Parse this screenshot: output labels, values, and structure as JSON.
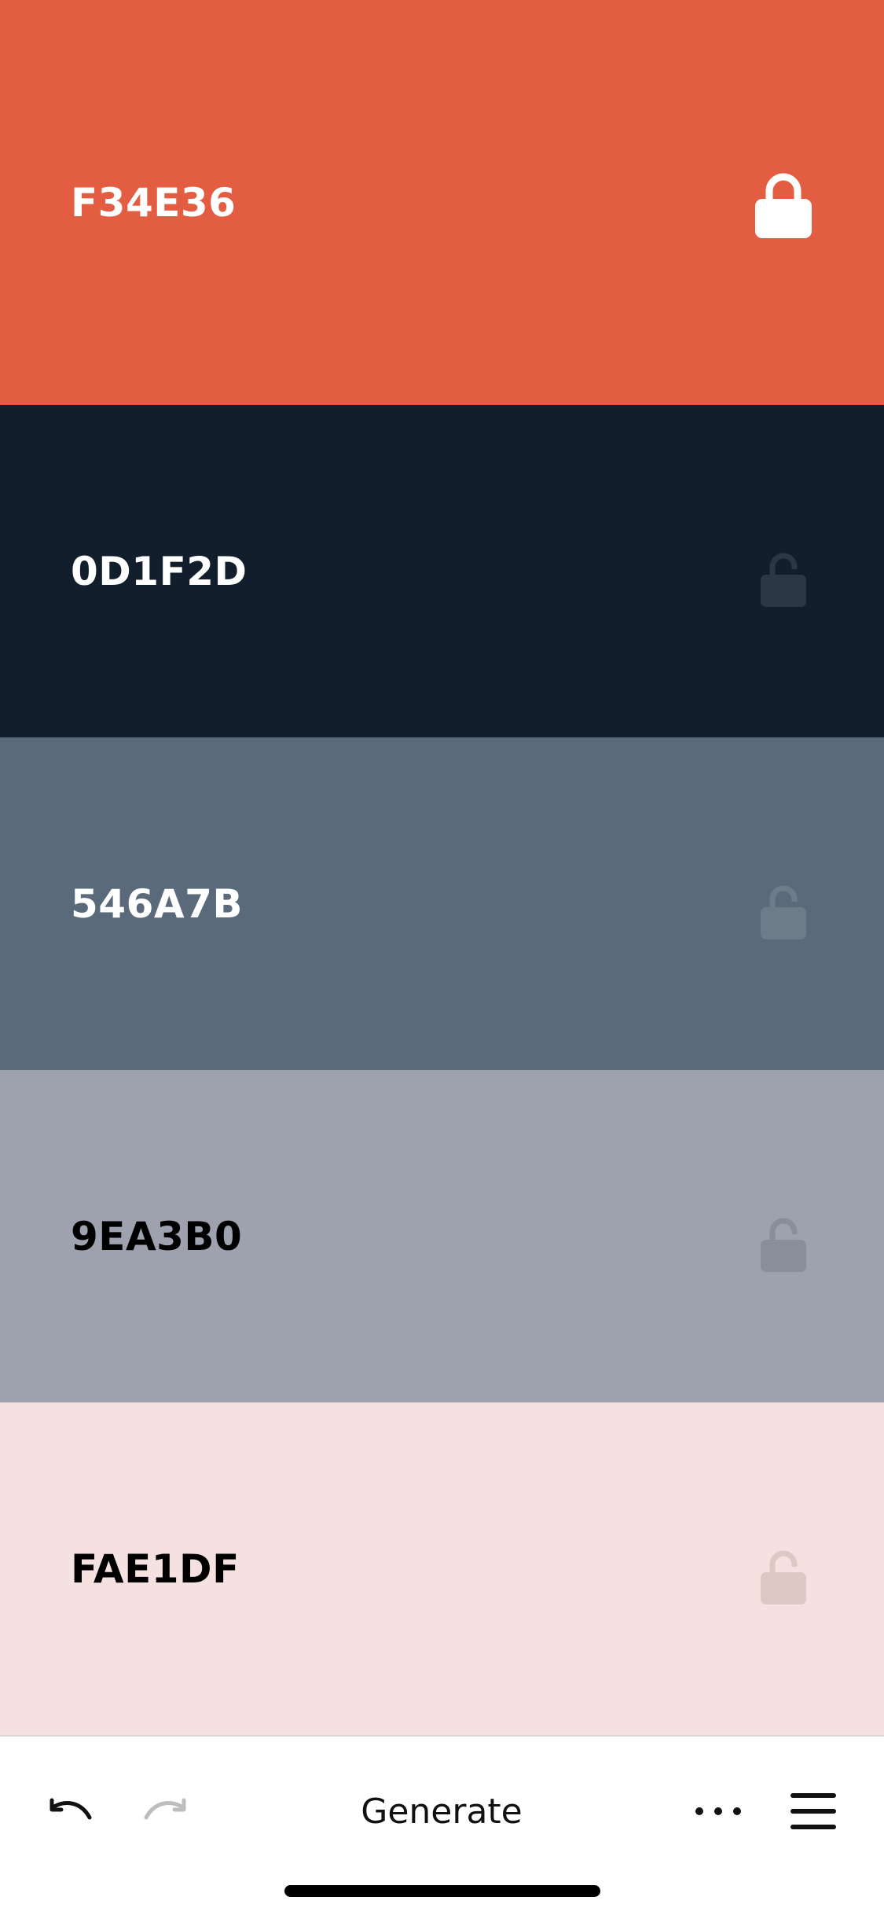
{
  "palette": {
    "swatches": [
      {
        "hex": "F34E36",
        "bg": "#E35D43",
        "text_color": "#FFFFFF",
        "lock_color": "#FFFFFF",
        "locked": true,
        "lock_icon": "lock-closed-icon"
      },
      {
        "hex": "0D1F2D",
        "bg": "#121E2C",
        "text_color": "#FFFFFF",
        "lock_color": "#2B3744",
        "locked": false,
        "lock_icon": "lock-open-icon"
      },
      {
        "hex": "546A7B",
        "bg": "#5B6A7A",
        "text_color": "#FFFFFF",
        "lock_color": "#6E7C8A",
        "locked": false,
        "lock_icon": "lock-open-icon"
      },
      {
        "hex": "9EA3B0",
        "bg": "#9EA2AF",
        "text_color": "#000000",
        "lock_color": "#898E9B",
        "locked": false,
        "lock_icon": "lock-open-icon"
      },
      {
        "hex": "FAE1DF",
        "bg": "#F5E1DF",
        "text_color": "#000000",
        "lock_color": "#DDC8C6",
        "locked": false,
        "lock_icon": "lock-open-icon"
      }
    ]
  },
  "toolbar": {
    "generate_label": "Generate",
    "undo_icon": "undo-icon",
    "redo_icon": "redo-icon",
    "more_icon": "more-horizontal-icon",
    "menu_icon": "hamburger-menu-icon",
    "redo_enabled": false
  }
}
